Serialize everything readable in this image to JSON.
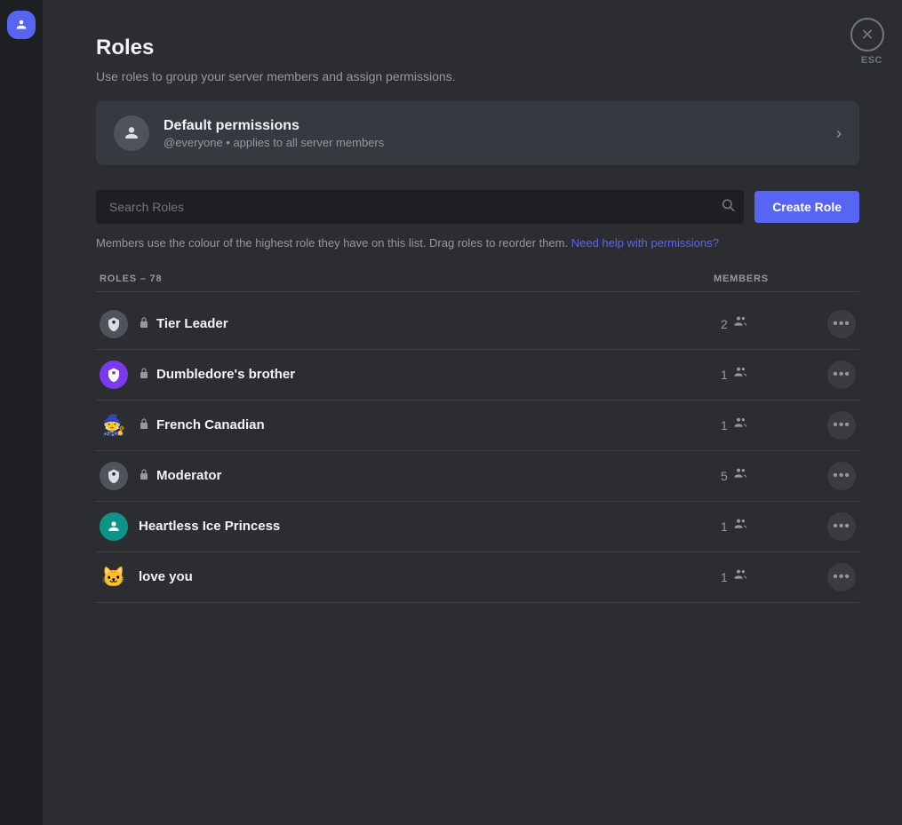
{
  "page": {
    "title": "Roles",
    "subtitle": "Use roles to group your server members and assign permissions.",
    "close_label": "ESC"
  },
  "default_permissions": {
    "title": "Default permissions",
    "subtitle": "@everyone • applies to all server members"
  },
  "search": {
    "placeholder": "Search Roles"
  },
  "create_role_button": "Create Role",
  "help_text": "Members use the colour of the highest role they have on this list. Drag roles to reorder them.",
  "help_link": "Need help with permissions?",
  "roles_count_label": "ROLES – 78",
  "members_column_label": "MEMBERS",
  "roles": [
    {
      "name": "Tier Leader",
      "icon_type": "gray",
      "icon_char": "🛡",
      "locked": true,
      "members": 2
    },
    {
      "name": "Dumbledore's brother",
      "icon_type": "purple",
      "icon_char": "🛡",
      "locked": true,
      "members": 1
    },
    {
      "name": "French Canadian",
      "icon_type": "emoji",
      "icon_char": "🧙",
      "locked": true,
      "members": 1
    },
    {
      "name": "Moderator",
      "icon_type": "gray",
      "icon_char": "🛡",
      "locked": true,
      "members": 5
    },
    {
      "name": "Heartless Ice Princess",
      "icon_type": "teal",
      "icon_char": "👤",
      "locked": false,
      "members": 1
    },
    {
      "name": "love you",
      "icon_type": "emoji",
      "icon_char": "🐱",
      "locked": false,
      "members": 1
    }
  ]
}
